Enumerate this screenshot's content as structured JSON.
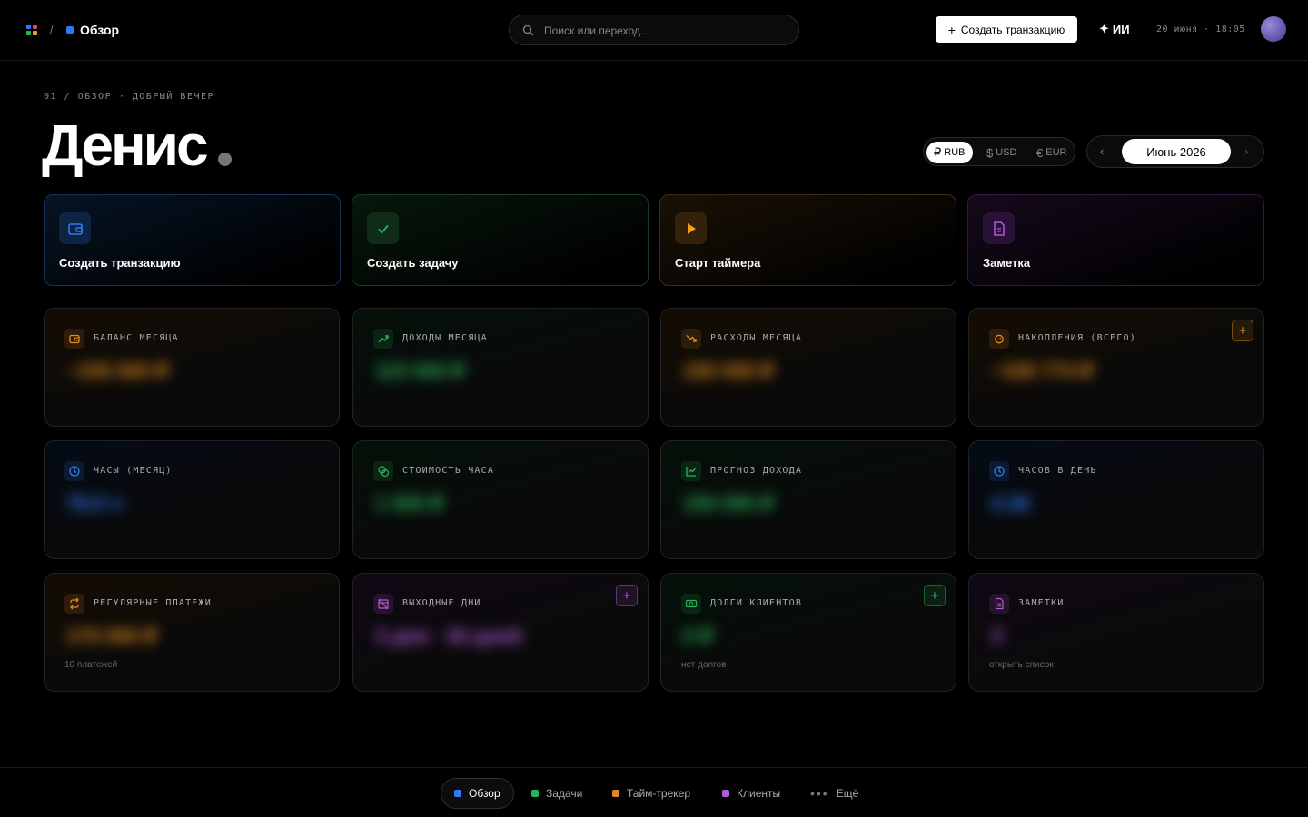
{
  "header": {
    "breadcrumb_sep": "/",
    "current_page": "Обзор",
    "search_placeholder": "Поиск или переход...",
    "create_button": "Создать транзакцию",
    "ai_label": "ИИ",
    "datetime": "20 июня · 18:05"
  },
  "greeting": {
    "eyebrow": "01 / ОБЗОР · ДОБРЫЙ ВЕЧЕР",
    "name": "Денис"
  },
  "currency": {
    "options": [
      {
        "symbol": "₽",
        "code": "RUB",
        "active": true
      },
      {
        "symbol": "$",
        "code": "USD",
        "active": false
      },
      {
        "symbol": "€",
        "code": "EUR",
        "active": false
      }
    ]
  },
  "month": {
    "label": "Июнь 2026",
    "prev": "‹",
    "next": "›"
  },
  "quick_actions": [
    {
      "label": "Создать транзакцию",
      "icon": "wallet-icon",
      "color": "#2f7bf5"
    },
    {
      "label": "Создать задачу",
      "icon": "check-icon",
      "color": "#2bb35a"
    },
    {
      "label": "Старт таймера",
      "icon": "play-icon",
      "color": "#f0a020"
    },
    {
      "label": "Заметка",
      "icon": "note-icon",
      "color": "#b05ad8"
    }
  ],
  "cards": [
    {
      "title": "БАЛАНС МЕСЯЦА",
      "value": "−155 000 ₽",
      "icon": "wallet-icon",
      "color": "#e08a1e"
    },
    {
      "title": "ДОХОДЫ МЕСЯЦА",
      "value": "115 000 ₽",
      "icon": "trend-up-icon",
      "color": "#2bb35a"
    },
    {
      "title": "РАСХОДЫ МЕСЯЦА",
      "value": "150 000 ₽",
      "icon": "trend-down-icon",
      "color": "#e08a1e"
    },
    {
      "title": "НАКОПЛЕНИЯ (ВСЕГО)",
      "value": "−100 774 ₽",
      "icon": "piggy-icon",
      "color": "#e08a1e",
      "plus": "+"
    },
    {
      "title": "ЧАСЫ (МЕСЯЦ)",
      "value": "78.5 ч",
      "icon": "clock-icon",
      "color": "#2f7bf5"
    },
    {
      "title": "СТОИМОСТЬ ЧАСА",
      "value": "1 500 ₽",
      "icon": "coins-icon",
      "color": "#2bb35a"
    },
    {
      "title": "ПРОГНОЗ ДОХОДА",
      "value": "150 000 ₽",
      "icon": "chart-icon",
      "color": "#2bb35a"
    },
    {
      "title": "ЧАСОВ В ДЕНЬ",
      "value": "4.36",
      "icon": "clock-icon",
      "color": "#2f7bf5"
    },
    {
      "title": "РЕГУЛЯРНЫЕ ПЛАТЕЖИ",
      "value": "170 000 ₽",
      "icon": "repeat-icon",
      "color": "#e08a1e",
      "sub": "10 платежей"
    },
    {
      "title": "ВЫХОДНЫЕ ДНИ",
      "value": "3 дня · 30 дней",
      "icon": "calendar-off-icon",
      "color": "#b05ad8",
      "plus": "+"
    },
    {
      "title": "ДОЛГИ КЛИЕНТОВ",
      "value": "0 ₽",
      "icon": "cash-icon",
      "color": "#2bb35a",
      "plus": "+",
      "sub": "нет долгов"
    },
    {
      "title": "ЗАМЕТКИ",
      "value": "3",
      "icon": "note-icon",
      "color": "#b05ad8",
      "sub": "открыть список"
    }
  ],
  "bottom_nav": [
    {
      "label": "Обзор",
      "color": "#2f7bf5",
      "active": true
    },
    {
      "label": "Задачи",
      "color": "#2bb35a",
      "active": false
    },
    {
      "label": "Тайм-трекер",
      "color": "#e08a1e",
      "active": false
    },
    {
      "label": "Клиенты",
      "color": "#b05ad8",
      "active": false
    },
    {
      "label": "Ещё",
      "color": "#777777",
      "active": false
    }
  ]
}
